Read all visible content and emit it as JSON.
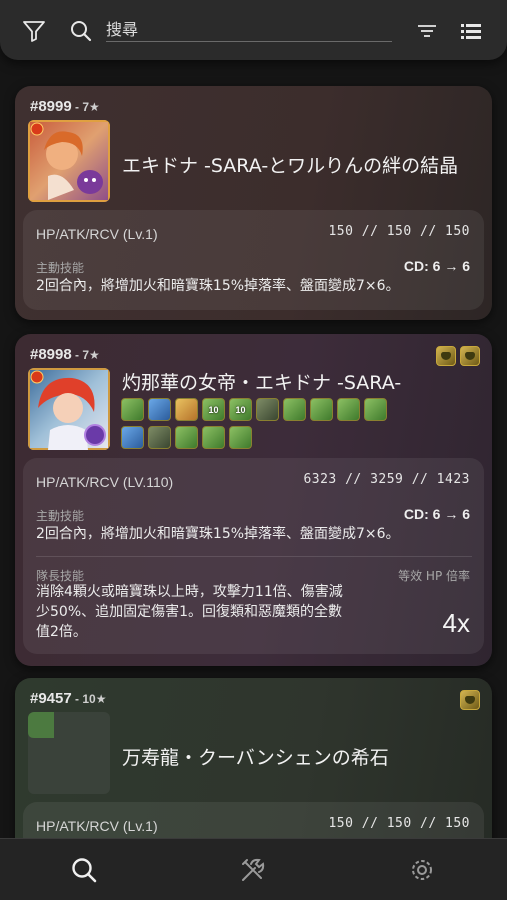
{
  "search": {
    "placeholder": "搜尋",
    "value": ""
  },
  "toolbar": {
    "filter_icon": "filter-icon",
    "search_icon": "search-icon",
    "sort_icon": "sort-icon",
    "list_icon": "list-view-icon"
  },
  "cards": [
    {
      "id": "#8999",
      "rarity": " - 7★",
      "name": "エキドナ -SARA-とワルりんの絆の結晶",
      "stat_label": "HP/ATK/RCV (Lv.1)",
      "stat_values": "150 // 150 // 150",
      "active_label": "主動技能",
      "cd": "CD: 6 → 6",
      "active_desc": "2回合內，將增加火和暗寶珠15%掉落率、盤面變成7×6。"
    },
    {
      "id": "#8998",
      "rarity": " - 7★",
      "name": "灼那華の女帝・エキドナ -SARA-",
      "stat_label": "HP/ATK/RCV (LV.110)",
      "stat_values": "6323 // 3259 // 1423",
      "active_label": "主動技能",
      "cd": "CD: 6 → 6",
      "active_desc": "2回合內，將增加火和暗寶珠15%掉落率、盤面變成7×6。",
      "leader_label": "隊長技能",
      "hp_label": "等效 HP 倍率",
      "leader_desc_1": "消除4顆火或暗寶珠以上時，攻擊力11倍、傷害減",
      "leader_desc_2": "少50%、追加固定傷害1。回復類和惡魔類的全數",
      "leader_desc_3": "值2倍。",
      "multiplier": "4x",
      "awakenings_row1": [
        "10",
        "10"
      ],
      "awakenings_row2": []
    },
    {
      "id": "#9457",
      "rarity": " - 10★",
      "name": "万寿龍・クーバンシェンの希石",
      "stat_label": "HP/ATK/RCV (Lv.1)",
      "stat_values": "150 // 150 // 150"
    }
  ],
  "tabs": {
    "search": "search-tab-icon",
    "tools": "tools-tab-icon",
    "settings": "settings-tab-icon"
  },
  "colors": {
    "accent": "#d3b552",
    "background": "#151515"
  }
}
